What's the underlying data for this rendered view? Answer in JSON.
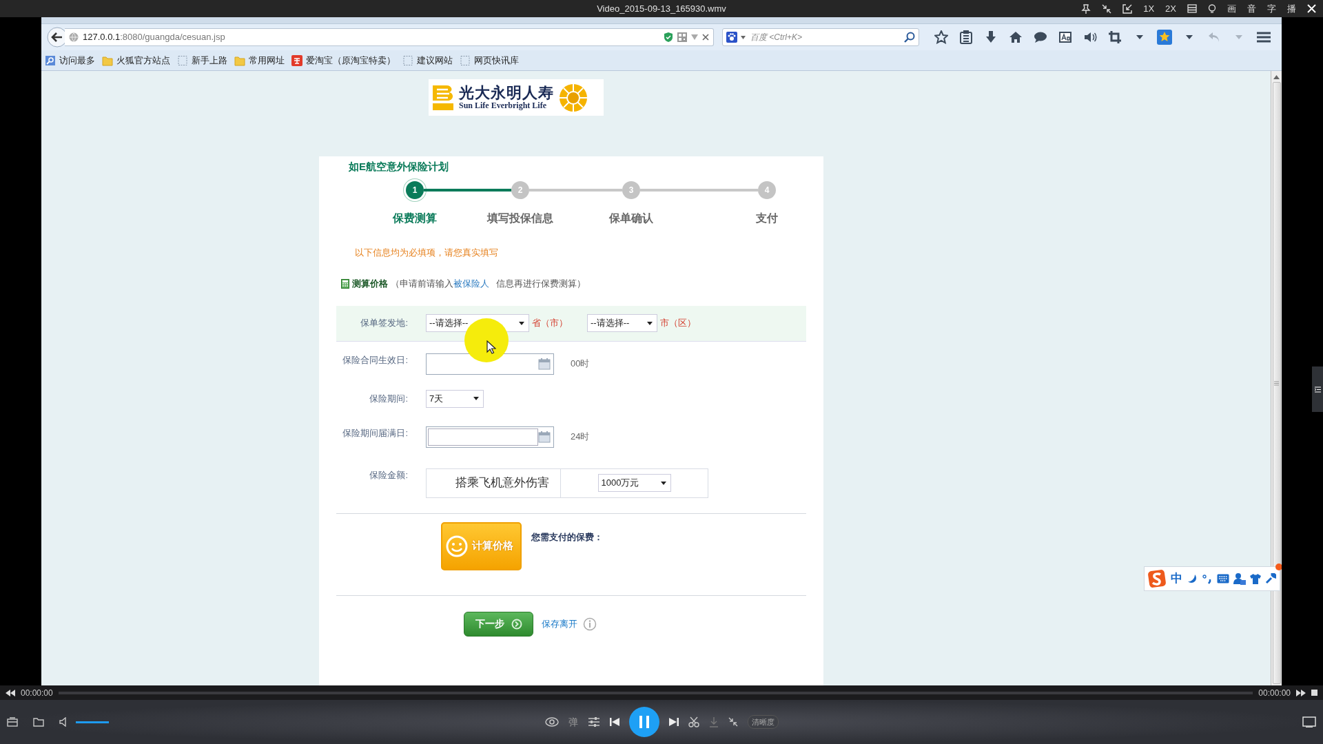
{
  "player": {
    "title": "Video_2015-09-13_165930.wmv",
    "speed_buttons": [
      "1X",
      "2X"
    ],
    "char_buttons": [
      "画",
      "音",
      "字",
      "播"
    ],
    "time_elapsed": "00:00:00",
    "time_total": "00:00:00",
    "progress": {
      "level": 0
    },
    "volume": {
      "level": 1
    },
    "danmaku_button": "弹",
    "quality_button": "清晰度"
  },
  "browser": {
    "url_host": "127.0.0.1",
    "url_path": ":8080/guangda/cesuan.jsp",
    "search_placeholder": "百度 <Ctrl+K>",
    "bookmarks": [
      {
        "label": "访问最多",
        "kind": "smart"
      },
      {
        "label": "火狐官方站点",
        "kind": "folder"
      },
      {
        "label": "新手上路",
        "kind": "page"
      },
      {
        "label": "常用网址",
        "kind": "folder"
      },
      {
        "label": "爱淘宝（原淘宝特卖）",
        "kind": "shop"
      },
      {
        "label": "建议网站",
        "kind": "page"
      },
      {
        "label": "网页快讯库",
        "kind": "page"
      }
    ]
  },
  "logo": {
    "name_cn": "光大永明人寿",
    "name_en": "Sun Life Everbright Life"
  },
  "page": {
    "plan_title": "如E航空意外保险计划",
    "steps": [
      {
        "number": "1",
        "label": "保费测算",
        "selected": true
      },
      {
        "number": "2",
        "label": "填写投保信息",
        "selected": false
      },
      {
        "number": "3",
        "label": "保单确认",
        "selected": false
      },
      {
        "number": "4",
        "label": "支付",
        "selected": false
      }
    ],
    "notice": "以下信息均为必填项，请您真实填写",
    "section": {
      "title": "测算价格",
      "note_before": "（申请前请输入",
      "link": "被保险人",
      "note_after": "信息再进行保费测算）"
    },
    "fields": [
      {
        "kind": "region",
        "label": "保单签发地:",
        "province_select": "--请选择--",
        "province_suffix": "省（市）",
        "city_select": "--请选择--",
        "city_suffix": "市（区）"
      },
      {
        "kind": "date",
        "label": "保险合同生效日:",
        "suffix": "00时"
      },
      {
        "kind": "select",
        "label": "保险期间:",
        "value": "7天"
      },
      {
        "kind": "date",
        "label": "保险期间届满日:",
        "suffix": "24时"
      },
      {
        "kind": "coverage",
        "label": "保险金额:",
        "item": "搭乘飞机意外伤害",
        "value": "1000万元"
      }
    ],
    "calc_button": "计算价格",
    "premium_label": "您需支付的保费：",
    "next_button": "下一步",
    "save_link": "保存离开"
  },
  "ime": {
    "mode": "中"
  }
}
